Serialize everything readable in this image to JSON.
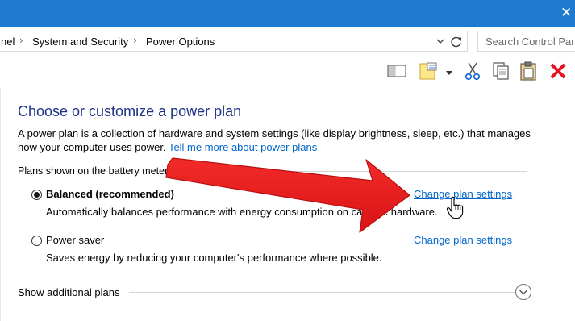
{
  "titlebar": {
    "close_glyph": "✕",
    "close_icon": "close-icon"
  },
  "address": {
    "crumbs": [
      "nel",
      "System and Security",
      "Power Options"
    ],
    "separator": "›",
    "search_placeholder": "Search Control Panel"
  },
  "toolbar": {
    "icons": [
      "layout-pane-icon",
      "properties-icon",
      "dropdown-arrow-icon",
      "cut-icon",
      "copy-icon",
      "paste-icon",
      "delete-icon"
    ]
  },
  "main": {
    "title": "Choose or customize a power plan",
    "description": "A power plan is a collection of hardware and system settings (like display brightness, sleep, etc.) that manages how your computer uses power.",
    "learn_more_link": "Tell me more about power plans",
    "group_label": "Plans shown on the battery meter",
    "plans": [
      {
        "name": "Balanced (recommended)",
        "selected": true,
        "description": "Automatically balances performance with energy consumption on capable hardware.",
        "link": "Change plan settings"
      },
      {
        "name": "Power saver",
        "selected": false,
        "description": "Saves energy by reducing your computer's performance where possible.",
        "link": "Change plan settings"
      }
    ],
    "additional_plans_label": "Show additional plans"
  },
  "colors": {
    "titlebar": "#1e7bd0",
    "heading": "#1e3287",
    "link": "#0066cc",
    "annotation_arrow": "#ea1c1c",
    "delete": "#e81123"
  }
}
